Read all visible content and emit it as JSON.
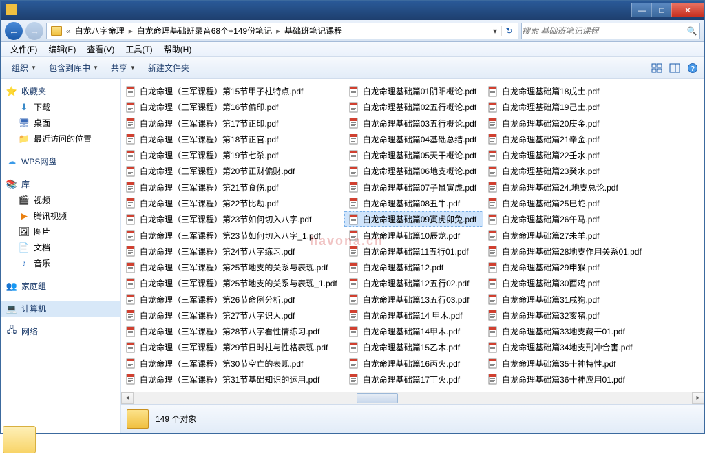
{
  "title_buttons": {
    "min": "—",
    "max": "□",
    "close": "✕"
  },
  "nav": {
    "back": "←",
    "forward": "→"
  },
  "breadcrumb": {
    "prefix": "«",
    "segments": [
      "白龙八字命理",
      "白龙命理基础班录音68个+149份笔记",
      "基础班笔记课程"
    ]
  },
  "search": {
    "placeholder": "搜索 基础班笔记课程"
  },
  "menubar": [
    "文件(F)",
    "编辑(E)",
    "查看(V)",
    "工具(T)",
    "帮助(H)"
  ],
  "toolbar": {
    "organize": "组织",
    "include": "包含到库中",
    "share": "共享",
    "newfolder": "新建文件夹"
  },
  "sidebar": {
    "favorites": {
      "label": "收藏夹",
      "items": [
        {
          "icon": "download",
          "label": "下载"
        },
        {
          "icon": "desktop",
          "label": "桌面"
        },
        {
          "icon": "recent",
          "label": "最近访问的位置"
        }
      ]
    },
    "wps": {
      "label": "WPS网盘"
    },
    "libraries": {
      "label": "库",
      "items": [
        {
          "icon": "video",
          "label": "视频"
        },
        {
          "icon": "tencent",
          "label": "腾讯视频"
        },
        {
          "icon": "picture",
          "label": "图片"
        },
        {
          "icon": "document",
          "label": "文档"
        },
        {
          "icon": "music",
          "label": "音乐"
        }
      ]
    },
    "homegroup": {
      "label": "家庭组"
    },
    "computer": {
      "label": "计算机"
    },
    "network": {
      "label": "网络"
    }
  },
  "columns": [
    [
      "白龙命理（三军课程）第15节甲子柱特点.pdf",
      "白龙命理（三军课程）第16节偏印.pdf",
      "白龙命理（三军课程）第17节正印.pdf",
      "白龙命理（三军课程）第18节正官.pdf",
      "白龙命理（三军课程）第19节七杀.pdf",
      "白龙命理（三军课程）第20节正财偏财.pdf",
      "白龙命理（三军课程）第21节食伤.pdf",
      "白龙命理（三军课程）第22节比劫.pdf",
      "白龙命理（三军课程）第23节如何切入八字.pdf",
      "白龙命理（三军课程）第23节如何切入八字_1.pdf",
      "白龙命理（三军课程）第24节八字练习.pdf",
      "白龙命理（三军课程）第25节地支的关系与表现.pdf",
      "白龙命理（三军课程）第25节地支的关系与表现_1.pdf",
      "白龙命理（三军课程）第26节命例分析.pdf",
      "白龙命理（三军课程）第27节八字识人.pdf",
      "白龙命理（三军课程）第28节八字看性情练习.pdf",
      "白龙命理（三军课程）第29节日时柱与性格表现.pdf",
      "白龙命理（三军课程）第30节空亡的表现.pdf",
      "白龙命理（三军课程）第31节基础知识的运用.pdf"
    ],
    [
      "白龙命理基础篇01阴阳概论.pdf",
      "白龙命理基础篇02五行概论.pdf",
      "白龙命理基础篇03五行概论.pdf",
      "白龙命理基础篇04基础总结.pdf",
      "白龙命理基础篇05天干概论.pdf",
      "白龙命理基础篇06地支概论.pdf",
      "白龙命理基础篇07子鼠寅虎.pdf",
      "白龙命理基础篇08丑牛.pdf",
      "白龙命理基础篇09寅虎卯兔.pdf",
      "白龙命理基础篇10辰龙.pdf",
      "白龙命理基础篇11五行01.pdf",
      "白龙命理基础篇12.pdf",
      "白龙命理基础篇12五行02.pdf",
      "白龙命理基础篇13五行03.pdf",
      "白龙命理基础篇14 甲木.pdf",
      "白龙命理基础篇14甲木.pdf",
      "白龙命理基础篇15乙木.pdf",
      "白龙命理基础篇16丙火.pdf",
      "白龙命理基础篇17丁火.pdf"
    ],
    [
      "白龙命理基础篇18戊土.pdf",
      "白龙命理基础篇19己土.pdf",
      "白龙命理基础篇20庚金.pdf",
      "白龙命理基础篇21辛金.pdf",
      "白龙命理基础篇22壬水.pdf",
      "白龙命理基础篇23癸水.pdf",
      "白龙命理基础篇24.地支总论.pdf",
      "白龙命理基础篇25巳蛇.pdf",
      "白龙命理基础篇26午马.pdf",
      "白龙命理基础篇27未羊.pdf",
      "白龙命理基础篇28地支作用关系01.pdf",
      "白龙命理基础篇29申猴.pdf",
      "白龙命理基础篇30酉鸡.pdf",
      "白龙命理基础篇31戌狗.pdf",
      "白龙命理基础篇32亥猪.pdf",
      "白龙命理基础篇33地支藏干01.pdf",
      "白龙命理基础篇34地支刑冲合害.pdf",
      "白龙命理基础篇35十神特性.pdf",
      "白龙命理基础篇36十神应用01.pdf"
    ]
  ],
  "selected": "白龙命理基础篇09寅虎卯兔.pdf",
  "status": {
    "text": "149 个对象"
  },
  "watermark": "havona.cn"
}
